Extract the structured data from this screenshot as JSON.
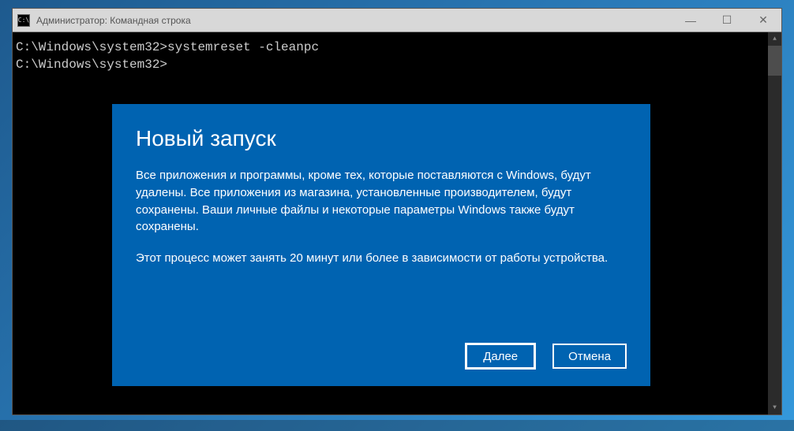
{
  "cmd": {
    "icon_text": "C:\\",
    "title": "Администратор: Командная строка",
    "line1": "C:\\Windows\\system32>systemreset -cleanpc",
    "line2": "",
    "line3": "C:\\Windows\\system32>"
  },
  "controls": {
    "minimize": "—",
    "maximize": "☐",
    "close": "✕"
  },
  "dialog": {
    "title": "Новый запуск",
    "paragraph1": "Все приложения и программы, кроме тех, которые поставляются с Windows, будут удалены. Все приложения из магазина, установленные производителем, будут сохранены. Ваши личные файлы и некоторые параметры Windows также будут сохранены.",
    "paragraph2": "Этот процесс может занять 20 минут или более в зависимости от работы устройства.",
    "next_label": "Далее",
    "cancel_label": "Отмена"
  },
  "scrollbar": {
    "up": "▲",
    "down": "▼"
  }
}
